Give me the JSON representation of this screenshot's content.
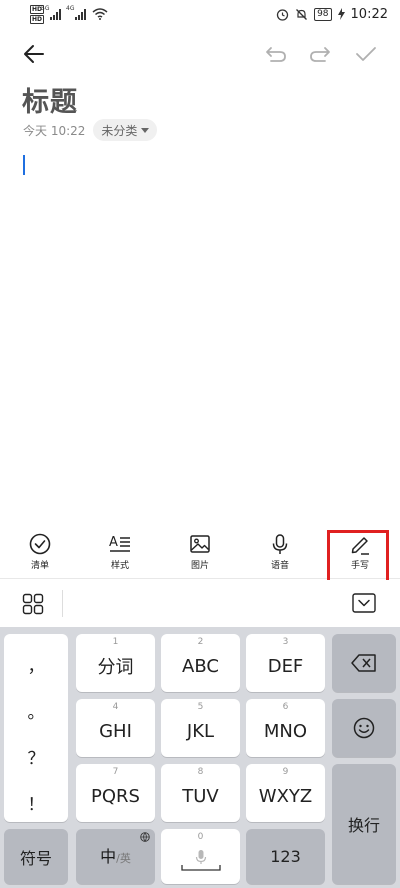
{
  "status_bar": {
    "sig1": "5G",
    "sig2": "4G",
    "battery": "98",
    "time": "10:22"
  },
  "note": {
    "title": "标题",
    "date": "今天 10:22",
    "category": "未分类"
  },
  "tools": [
    {
      "label": "清单",
      "icon": "check-circle-icon"
    },
    {
      "label": "样式",
      "icon": "text-style-icon"
    },
    {
      "label": "图片",
      "icon": "image-icon"
    },
    {
      "label": "语音",
      "icon": "microphone-icon"
    },
    {
      "label": "手写",
      "icon": "pen-icon"
    }
  ],
  "highlight_color": "#e02020",
  "keyboard": {
    "punctuation": [
      "，",
      "。",
      "？",
      "！"
    ],
    "keys": [
      {
        "num": "1",
        "label": "分词"
      },
      {
        "num": "2",
        "label": "ABC"
      },
      {
        "num": "3",
        "label": "DEF"
      },
      {
        "num": "4",
        "label": "GHI"
      },
      {
        "num": "5",
        "label": "JKL"
      },
      {
        "num": "6",
        "label": "MNO"
      },
      {
        "num": "7",
        "label": "PQRS"
      },
      {
        "num": "8",
        "label": "TUV"
      },
      {
        "num": "9",
        "label": "WXYZ"
      }
    ],
    "symbols_label": "符号",
    "lang_main": "中",
    "lang_alt": "/英",
    "space_num": "0",
    "numbers_label": "123",
    "enter_label": "换行"
  }
}
